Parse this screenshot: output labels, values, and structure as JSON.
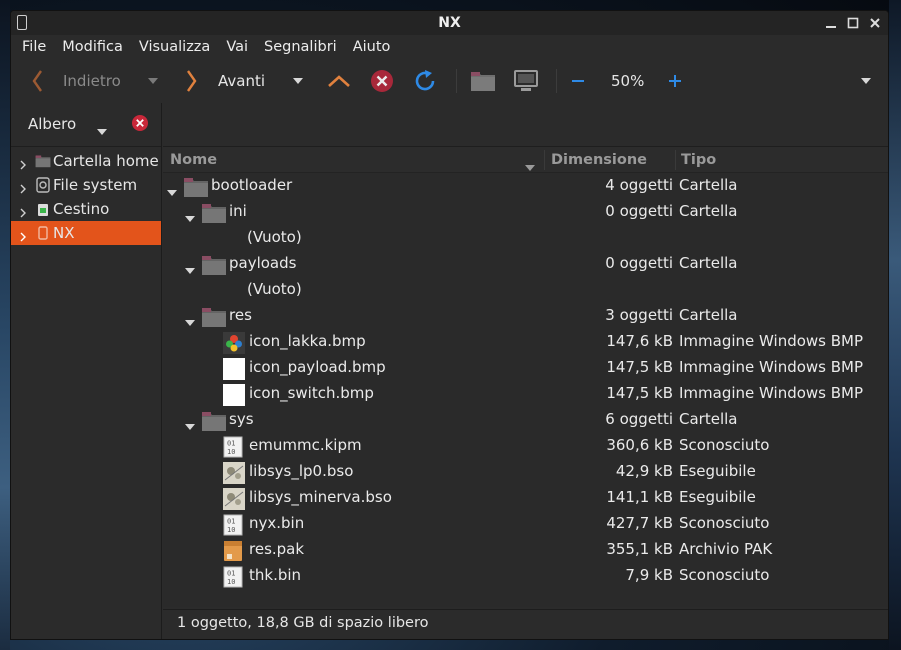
{
  "window": {
    "title": "NX"
  },
  "menu": [
    "File",
    "Modifica",
    "Visualizza",
    "Vai",
    "Segnalibri",
    "Aiuto"
  ],
  "toolbar": {
    "back_label": "Indietro",
    "forward_label": "Avanti",
    "zoom": "50%"
  },
  "sidebar": {
    "header_label": "Albero",
    "items": [
      {
        "label": "Cartella home",
        "icon": "home-folder-icon"
      },
      {
        "label": "File system",
        "icon": "drive-icon"
      },
      {
        "label": "Cestino",
        "icon": "trash-icon"
      },
      {
        "label": "NX",
        "icon": "usb-drive-icon",
        "selected": true
      }
    ]
  },
  "columns": {
    "name": "Nome",
    "size": "Dimensione",
    "type": "Tipo"
  },
  "rows": [
    {
      "name": "bootloader",
      "size": "4 oggetti",
      "type": "Cartella",
      "kind": "folder",
      "level": 0,
      "expanded": true
    },
    {
      "name": "ini",
      "size": "0 oggetti",
      "type": "Cartella",
      "kind": "folder",
      "level": 1,
      "expanded": true
    },
    {
      "name": "(Vuoto)",
      "size": "",
      "type": "",
      "kind": "empty",
      "level": 2
    },
    {
      "name": "payloads",
      "size": "0 oggetti",
      "type": "Cartella",
      "kind": "folder",
      "level": 1,
      "expanded": true
    },
    {
      "name": "(Vuoto)",
      "size": "",
      "type": "",
      "kind": "empty",
      "level": 2
    },
    {
      "name": "res",
      "size": "3 oggetti",
      "type": "Cartella",
      "kind": "folder",
      "level": 1,
      "expanded": true
    },
    {
      "name": "icon_lakka.bmp",
      "size": "147,6 kB",
      "type": "Immagine Windows BMP",
      "kind": "lakka",
      "level": 2
    },
    {
      "name": "icon_payload.bmp",
      "size": "147,5 kB",
      "type": "Immagine Windows BMP",
      "kind": "blank",
      "level": 2
    },
    {
      "name": "icon_switch.bmp",
      "size": "147,5 kB",
      "type": "Immagine Windows BMP",
      "kind": "blank",
      "level": 2
    },
    {
      "name": "sys",
      "size": "6 oggetti",
      "type": "Cartella",
      "kind": "folder",
      "level": 1,
      "expanded": true
    },
    {
      "name": "emummc.kipm",
      "size": "360,6 kB",
      "type": "Sconosciuto",
      "kind": "binary",
      "level": 2
    },
    {
      "name": "libsys_lp0.bso",
      "size": "42,9 kB",
      "type": "Eseguibile",
      "kind": "exec",
      "level": 2
    },
    {
      "name": "libsys_minerva.bso",
      "size": "141,1 kB",
      "type": "Eseguibile",
      "kind": "exec",
      "level": 2
    },
    {
      "name": "nyx.bin",
      "size": "427,7 kB",
      "type": "Sconosciuto",
      "kind": "binary",
      "level": 2
    },
    {
      "name": "res.pak",
      "size": "355,1 kB",
      "type": "Archivio PAK",
      "kind": "archive",
      "level": 2
    },
    {
      "name": "thk.bin",
      "size": "7,9 kB",
      "type": "Sconosciuto",
      "kind": "binary",
      "level": 2
    }
  ],
  "status": {
    "text": "1 oggetto, 18,8 GB di spazio libero"
  },
  "colors": {
    "accent": "#e3541b",
    "folder": "#6f6f6f",
    "folder_tab": "#8a4d63",
    "back_arrow": "#d07638",
    "reload": "#2e8ae6"
  }
}
